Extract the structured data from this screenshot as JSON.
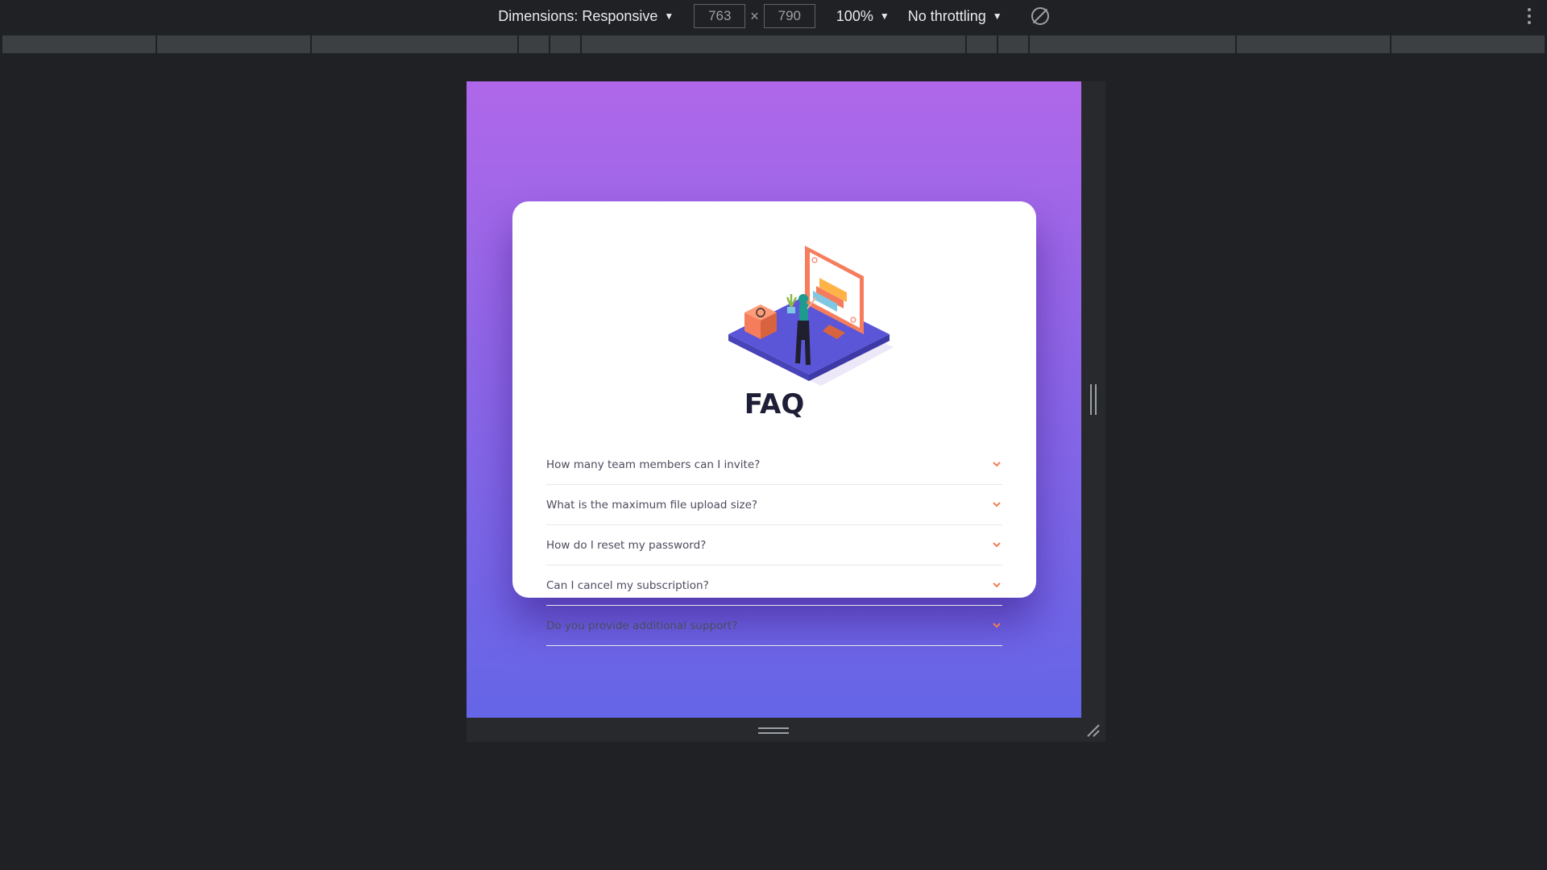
{
  "toolbar": {
    "dimensions_label": "Dimensions: Responsive",
    "width_value": "763",
    "times": "×",
    "height_value": "790",
    "zoom": "100%",
    "throttling": "No throttling"
  },
  "faq": {
    "title": "FAQ",
    "questions": [
      "How many team members can I invite?",
      "What is the maximum file upload size?",
      "How do I reset my password?",
      "Can I cancel my subscription?",
      "Do you provide additional support?"
    ]
  },
  "colors": {
    "gradient_top": "#af67e9",
    "gradient_bottom": "#6565e7",
    "title": "#1e1f36",
    "question_text": "#4b4c5f",
    "chevron": "#f47c57",
    "devtools_bg": "#202124"
  },
  "icons": {
    "dropdown": "caret-down-icon",
    "rotate": "rotate-icon",
    "more": "kebab-icon",
    "faq_toggle": "chevron-down-icon"
  }
}
